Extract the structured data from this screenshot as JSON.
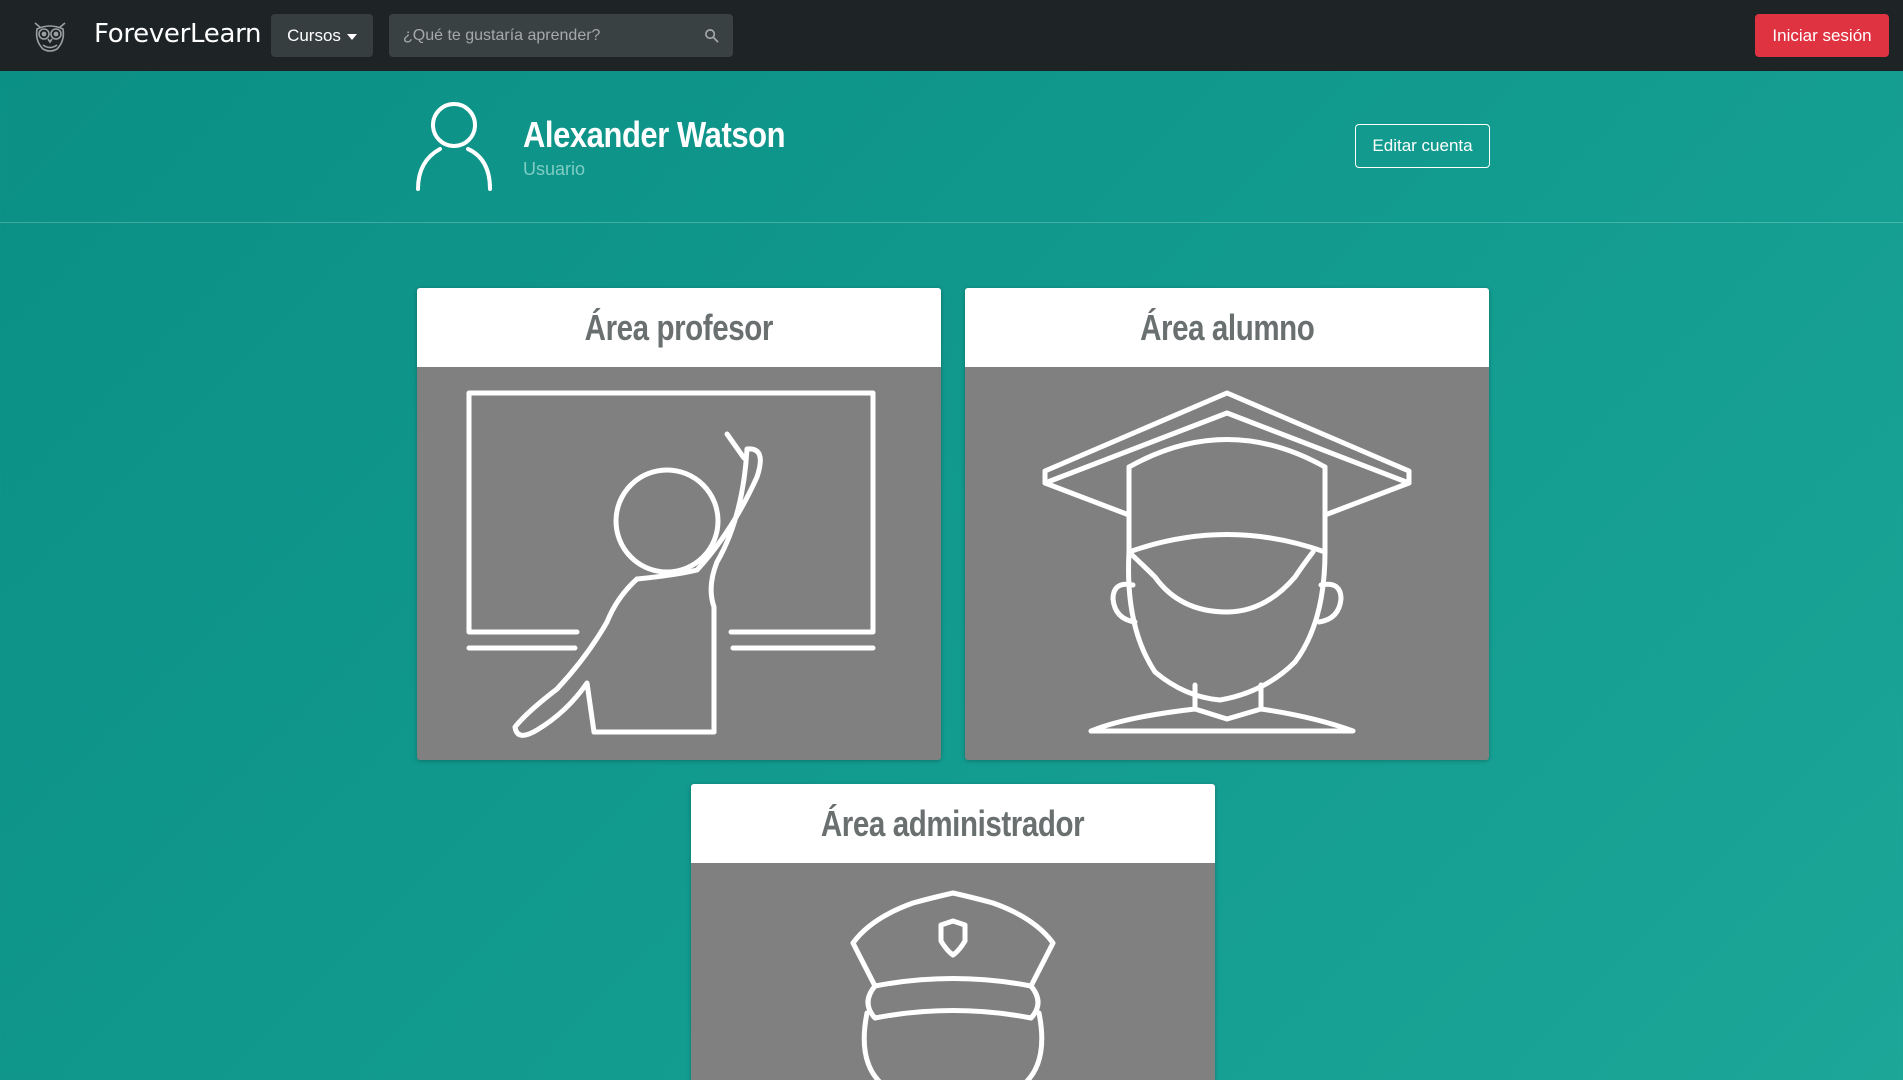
{
  "navbar": {
    "brand": "ForeverLearn",
    "brand_logo_icon": "owl-logo-icon",
    "courses_label": "Cursos",
    "search": {
      "placeholder": "¿Qué te gustaría aprender?",
      "value": ""
    },
    "login_label": "Iniciar sesión",
    "colors": {
      "navbar_bg": "#1e2425",
      "login_bg": "#e03342"
    }
  },
  "profile": {
    "name": "Alexander Watson",
    "role": "Usuario",
    "avatar_icon": "user-outline-icon",
    "edit_label": "Editar cuenta"
  },
  "areas": [
    {
      "title": "Área profesor",
      "icon": "teacher-at-board-icon"
    },
    {
      "title": "Área alumno",
      "icon": "graduate-student-icon"
    },
    {
      "title": "Área administrador",
      "icon": "police-officer-icon"
    }
  ],
  "theme": {
    "background": "#129b8f",
    "card_bg": "#808080",
    "card_title_color": "#6a6f70"
  }
}
